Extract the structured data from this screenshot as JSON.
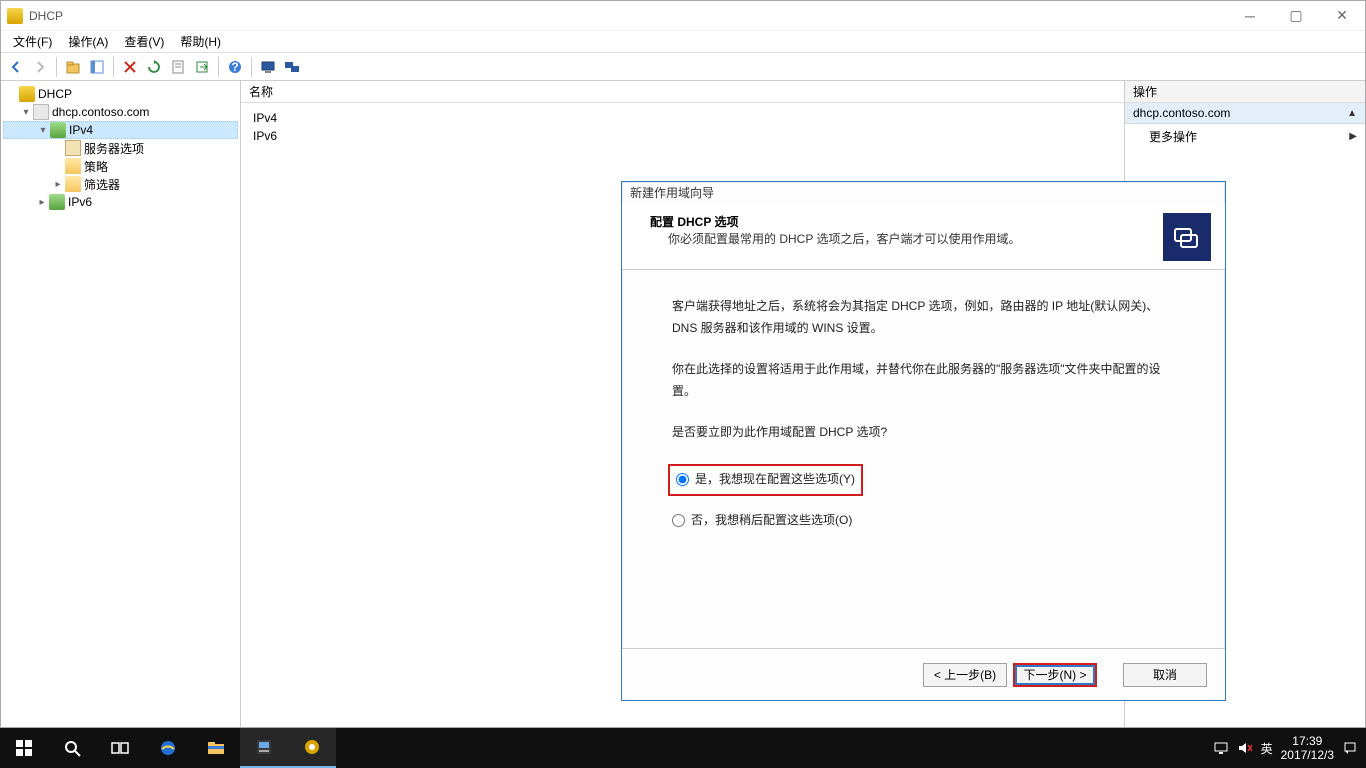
{
  "window": {
    "title": "DHCP"
  },
  "menu": {
    "file": "文件(F)",
    "action": "操作(A)",
    "view": "查看(V)",
    "help": "帮助(H)"
  },
  "tree": {
    "root": "DHCP",
    "server": "dhcp.contoso.com",
    "ipv4": "IPv4",
    "serveropts": "服务器选项",
    "policy": "策略",
    "filters": "筛选器",
    "ipv6": "IPv6"
  },
  "center": {
    "header": "名称",
    "ipv4": "IPv4",
    "ipv6": "IPv6"
  },
  "actions": {
    "header": "操作",
    "group": "dhcp.contoso.com",
    "more": "更多操作"
  },
  "wizard": {
    "caption": "新建作用域向导",
    "heading": "配置 DHCP 选项",
    "subheading": "你必须配置最常用的 DHCP 选项之后，客户端才可以使用作用域。",
    "para1": "客户端获得地址之后，系统将会为其指定 DHCP 选项，例如，路由器的 IP 地址(默认网关)、DNS 服务器和该作用域的 WINS 设置。",
    "para2": "你在此选择的设置将适用于此作用域，并替代你在此服务器的\"服务器选项\"文件夹中配置的设置。",
    "question": "是否要立即为此作用域配置 DHCP 选项?",
    "opt_yes": "是，我想现在配置这些选项(Y)",
    "opt_no": "否，我想稍后配置这些选项(O)",
    "back": "< 上一步(B)",
    "next": "下一步(N) >",
    "cancel": "取消"
  },
  "taskbar": {
    "ime": "英",
    "time": "17:39",
    "date": "2017/12/3"
  }
}
